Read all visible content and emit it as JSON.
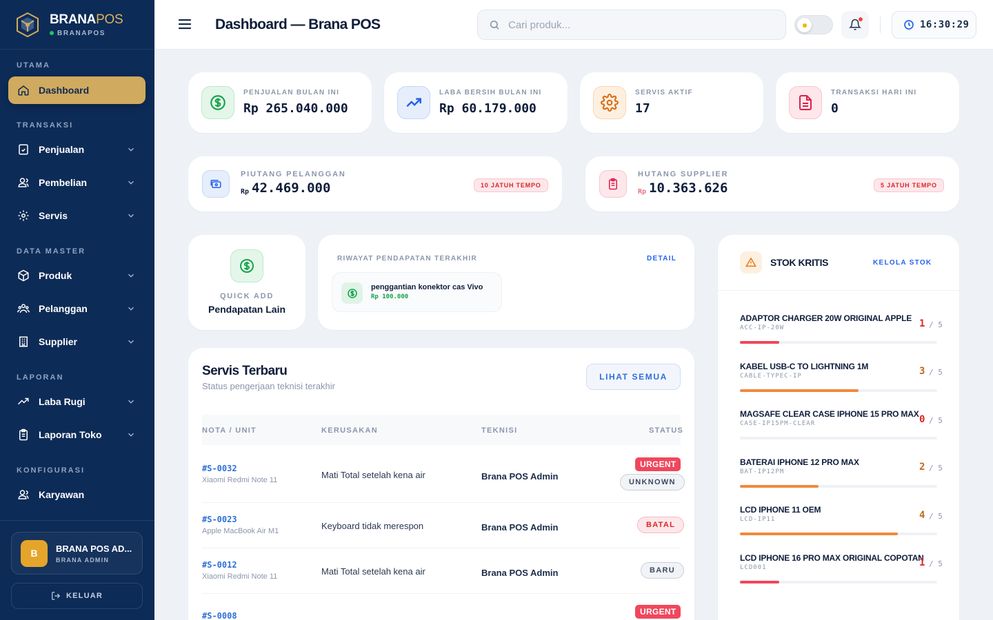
{
  "brand": {
    "name_main": "BRANA",
    "name_accent": "POS",
    "subtitle": "BRANAPOS"
  },
  "sidebar": {
    "sections": [
      {
        "label": "UTAMA",
        "items": [
          {
            "label": "Dashboard",
            "icon": "home-icon",
            "active": true
          }
        ]
      },
      {
        "label": "TRANSAKSI",
        "items": [
          {
            "label": "Penjualan",
            "icon": "receipt-icon"
          },
          {
            "label": "Pembelian",
            "icon": "users-icon"
          },
          {
            "label": "Servis",
            "icon": "gear-icon"
          }
        ]
      },
      {
        "label": "DATA MASTER",
        "items": [
          {
            "label": "Produk",
            "icon": "box-icon"
          },
          {
            "label": "Pelanggan",
            "icon": "group-icon"
          },
          {
            "label": "Supplier",
            "icon": "building-icon"
          }
        ]
      },
      {
        "label": "LAPORAN",
        "items": [
          {
            "label": "Laba Rugi",
            "icon": "trend-icon"
          },
          {
            "label": "Laporan Toko",
            "icon": "clipboard-icon"
          }
        ]
      },
      {
        "label": "KONFIGURASI",
        "items": [
          {
            "label": "Karyawan",
            "icon": "users-icon"
          }
        ]
      }
    ],
    "user": {
      "initial": "B",
      "name": "BRANA POS AD...",
      "role": "BRANA ADMIN"
    },
    "logout_label": "KELUAR"
  },
  "header": {
    "title": "Dashboard — Brana POS",
    "search_placeholder": "Cari produk...",
    "time": "16:30:29"
  },
  "stats": [
    {
      "label": "PENJUALAN BULAN INI",
      "value": "Rp 265.040.000",
      "icon": "dollar-icon",
      "color": "#16a34a"
    },
    {
      "label": "LABA BERSIH BULAN INI",
      "value": "Rp 60.179.000",
      "icon": "trend-up-icon",
      "color": "#2563eb"
    },
    {
      "label": "SERVIS AKTIF",
      "value": "17",
      "icon": "gear-icon",
      "color": "#ea7a16"
    },
    {
      "label": "TRANSAKSI HARI INI",
      "value": "0",
      "icon": "document-icon",
      "color": "#e11d48"
    }
  ],
  "debts": [
    {
      "label": "PIUTANG PELANGGAN",
      "currency": "Rp",
      "value": "42.469.000",
      "badge": "10 JATUH TEMPO"
    },
    {
      "label": "HUTANG SUPPLIER",
      "currency": "Rp",
      "value": "10.363.626",
      "badge": "5 JATUH TEMPO"
    }
  ],
  "quick_add": {
    "label": "QUICK ADD",
    "title": "Pendapatan Lain"
  },
  "income_history": {
    "title": "RIWAYAT PENDAPATAN TERAKHIR",
    "detail_label": "DETAIL",
    "items": [
      {
        "name": "penggantian konektor cas Vivo",
        "amount": "Rp 100.000"
      }
    ]
  },
  "services": {
    "title": "Servis Terbaru",
    "subtitle": "Status pengerjaan teknisi terakhir",
    "see_all_label": "LIHAT SEMUA",
    "columns": [
      "NOTA / UNIT",
      "KERUSAKAN",
      "TEKNISI",
      "STATUS"
    ],
    "rows": [
      {
        "nota": "#S-0032",
        "unit": "Xiaomi Redmi Note 11",
        "damage": "Mati Total setelah kena air",
        "tech": "Brana POS Admin",
        "urgent": "URGENT",
        "status": "UNKNOWN"
      },
      {
        "nota": "#S-0023",
        "unit": "Apple MacBook Air M1",
        "damage": "Keyboard tidak merespon",
        "tech": "Brana POS Admin",
        "urgent": "",
        "status": "BATAL"
      },
      {
        "nota": "#S-0012",
        "unit": "Xiaomi Redmi Note 11",
        "damage": "Mati Total setelah kena air",
        "tech": "Brana POS Admin",
        "urgent": "",
        "status": "BARU"
      },
      {
        "nota": "#S-0008",
        "unit": "",
        "damage": "",
        "tech": "",
        "urgent": "URGENT",
        "status": ""
      }
    ]
  },
  "stock": {
    "title": "STOK KRITIS",
    "manage_label": "KELOLA STOK",
    "items": [
      {
        "name": "ADAPTOR CHARGER 20W ORIGINAL APPLE",
        "code": "ACC-IP-20W",
        "qty": "1",
        "max": "/ 5",
        "level": 0.2,
        "color": "#f0475c"
      },
      {
        "name": "KABEL USB-C TO LIGHTNING 1M",
        "code": "CABLE-TYPEC-IP",
        "qty": "3",
        "max": "/ 5",
        "level": 0.6,
        "color": "#f08a3c"
      },
      {
        "name": "MAGSAFE CLEAR CASE IPHONE 15 PRO MAX",
        "code": "CASE-IP15PM-CLEAR",
        "qty": "0",
        "max": "/ 5",
        "level": 0,
        "color": "#f0475c"
      },
      {
        "name": "BATERAI IPHONE 12 PRO MAX",
        "code": "BAT-IP12PM",
        "qty": "2",
        "max": "/ 5",
        "level": 0.4,
        "color": "#f08a3c"
      },
      {
        "name": "LCD IPHONE 11 OEM",
        "code": "LCD-IP11",
        "qty": "4",
        "max": "/ 5",
        "level": 0.8,
        "color": "#f08a3c"
      },
      {
        "name": "LCD IPHONE 16 PRO MAX ORIGINAL COPOTAN",
        "code": "LCD001",
        "qty": "1",
        "max": "/ 5",
        "level": 0.2,
        "color": "#f0475c"
      }
    ]
  }
}
